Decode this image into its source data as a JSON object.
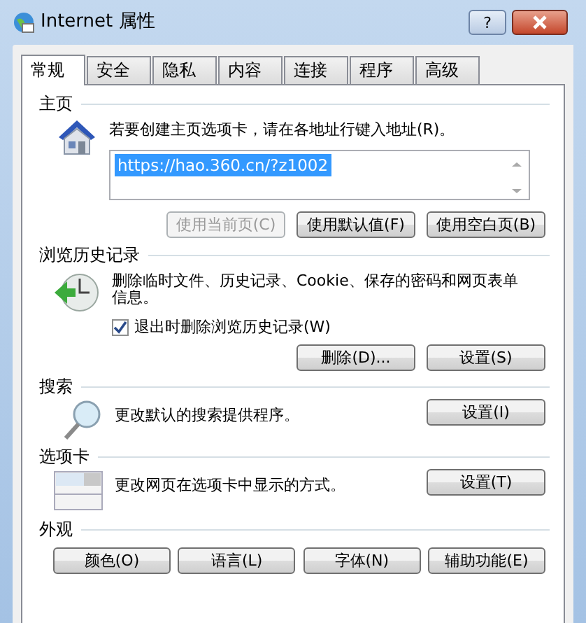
{
  "window": {
    "title": "Internet 属性",
    "help_button": "?"
  },
  "tabs": [
    {
      "label": "常规",
      "selected": true
    },
    {
      "label": "安全",
      "selected": false
    },
    {
      "label": "隐私",
      "selected": false
    },
    {
      "label": "内容",
      "selected": false
    },
    {
      "label": "连接",
      "selected": false
    },
    {
      "label": "程序",
      "selected": false
    },
    {
      "label": "高级",
      "selected": false
    }
  ],
  "home_page": {
    "heading": "主页",
    "description": "若要创建主页选项卡，请在各地址行键入地址(R)。",
    "address": "https://hao.360.cn/?z1002",
    "address_selected": true,
    "buttons": [
      {
        "label": "使用当前页(C)",
        "disabled": true
      },
      {
        "label": "使用默认值(F)",
        "disabled": false
      },
      {
        "label": "使用空白页(B)",
        "disabled": false
      }
    ]
  },
  "browsing_history": {
    "heading": "浏览历史记录",
    "description": "删除临时文件、历史记录、Cookie、保存的密码和网页表单信息。",
    "checkbox": {
      "label": "退出时删除浏览历史记录(W)",
      "checked": true
    },
    "buttons": [
      {
        "label": "删除(D)...",
        "disabled": false
      },
      {
        "label": "设置(S)",
        "disabled": false
      }
    ]
  },
  "search": {
    "heading": "搜索",
    "description": "更改默认的搜索提供程序。",
    "button": "设置(I)"
  },
  "tabs_section": {
    "heading": "选项卡",
    "description": "更改网页在选项卡中显示的方式。",
    "button": "设置(T)"
  },
  "appearance": {
    "heading": "外观",
    "buttons": [
      "颜色(O)",
      "语言(L)",
      "字体(N)",
      "辅助功能(E)"
    ]
  }
}
